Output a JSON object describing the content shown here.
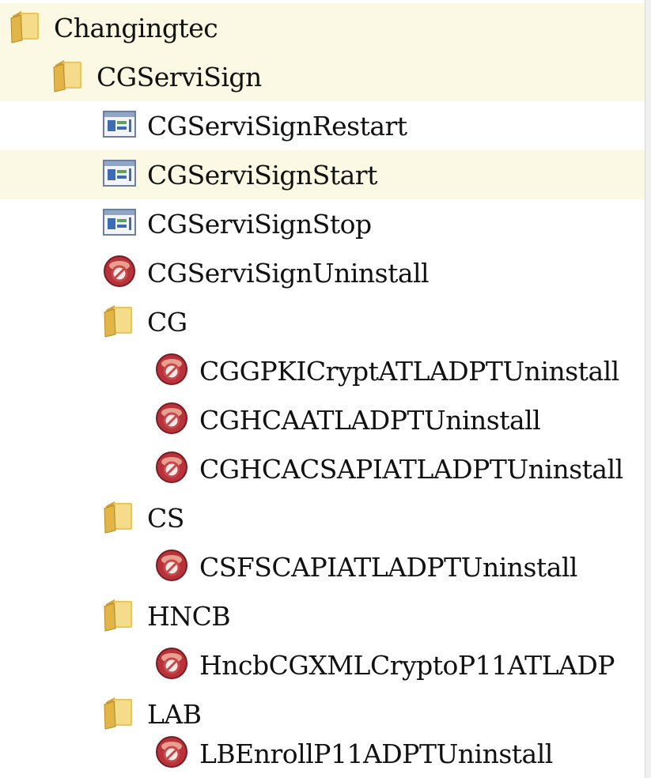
{
  "tree": {
    "items": [
      {
        "label": "Changingtec",
        "icon": "folder-icon",
        "depth": 0,
        "expanded": true
      },
      {
        "label": "CGServiSign",
        "icon": "folder-icon",
        "depth": 1,
        "expanded": true
      },
      {
        "label": "CGServiSignRestart",
        "icon": "app-window-icon",
        "depth": 2
      },
      {
        "label": "CGServiSignStart",
        "icon": "app-window-icon",
        "depth": 2
      },
      {
        "label": "CGServiSignStop",
        "icon": "app-window-icon",
        "depth": 2
      },
      {
        "label": "CGServiSignUninstall",
        "icon": "uninstall-icon",
        "depth": 2
      },
      {
        "label": "CG",
        "icon": "folder-icon",
        "depth": 2,
        "expanded": true
      },
      {
        "label": "CGGPKICryptATLADPTUninstall",
        "icon": "uninstall-icon",
        "depth": 3
      },
      {
        "label": "CGHCAATLADPTUninstall",
        "icon": "uninstall-icon",
        "depth": 3
      },
      {
        "label": "CGHCACSAPIATLADPTUninstall",
        "icon": "uninstall-icon",
        "depth": 3
      },
      {
        "label": "CS",
        "icon": "folder-icon",
        "depth": 2,
        "expanded": true
      },
      {
        "label": "CSFSCAPIATLADPTUninstall",
        "icon": "uninstall-icon",
        "depth": 3
      },
      {
        "label": "HNCB",
        "icon": "folder-icon",
        "depth": 2,
        "expanded": true
      },
      {
        "label": "HncbCGXMLCryptoP11ATLADP",
        "icon": "uninstall-icon",
        "depth": 3
      },
      {
        "label": "LAB",
        "icon": "folder-icon",
        "depth": 2,
        "expanded": true
      },
      {
        "label": "LBEnrollP11ADPTUninstall",
        "icon": "uninstall-icon",
        "depth": 3
      }
    ],
    "highlighted": [
      "Changingtec",
      "CGServiSign",
      "CGServiSignStart"
    ]
  },
  "colors": {
    "highlight": "#fbf9e3",
    "folder": "#e3b743",
    "uninstall": "#b8323c",
    "app_window": "#3b6db5"
  }
}
